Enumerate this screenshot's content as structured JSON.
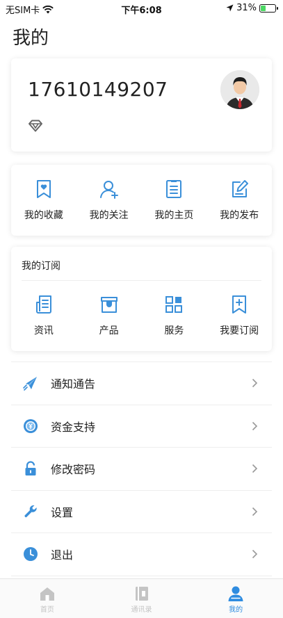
{
  "status_bar": {
    "carrier": "无SIM卡",
    "time": "下午6:08",
    "battery_percent": "31%",
    "battery_level": 0.31
  },
  "page": {
    "title": "我的"
  },
  "profile": {
    "phone": "17610149207"
  },
  "actions": [
    {
      "label": "我的收藏",
      "icon": "bookmark-heart-icon"
    },
    {
      "label": "我的关注",
      "icon": "user-add-icon"
    },
    {
      "label": "我的主页",
      "icon": "document-list-icon"
    },
    {
      "label": "我的发布",
      "icon": "edit-icon"
    }
  ],
  "subscriptions": {
    "title": "我的订阅",
    "items": [
      {
        "label": "资讯",
        "icon": "news-icon"
      },
      {
        "label": "产品",
        "icon": "store-icon"
      },
      {
        "label": "服务",
        "icon": "grid-icon"
      },
      {
        "label": "我要订阅",
        "icon": "bookmark-add-icon"
      }
    ]
  },
  "menu": [
    {
      "label": "通知通告",
      "icon": "megaphone-icon"
    },
    {
      "label": "资金支持",
      "icon": "coin-icon"
    },
    {
      "label": "修改密码",
      "icon": "lock-icon"
    },
    {
      "label": "设置",
      "icon": "wrench-icon"
    },
    {
      "label": "退出",
      "icon": "clock-icon"
    }
  ],
  "tabbar": [
    {
      "label": "首页",
      "icon": "home-icon",
      "active": false
    },
    {
      "label": "通讯录",
      "icon": "contacts-icon",
      "active": false
    },
    {
      "label": "我的",
      "icon": "person-icon",
      "active": true
    }
  ],
  "colors": {
    "accent": "#2f8ce0",
    "icon_blue": "#3a8fd9",
    "inactive": "#c4c4c4"
  }
}
